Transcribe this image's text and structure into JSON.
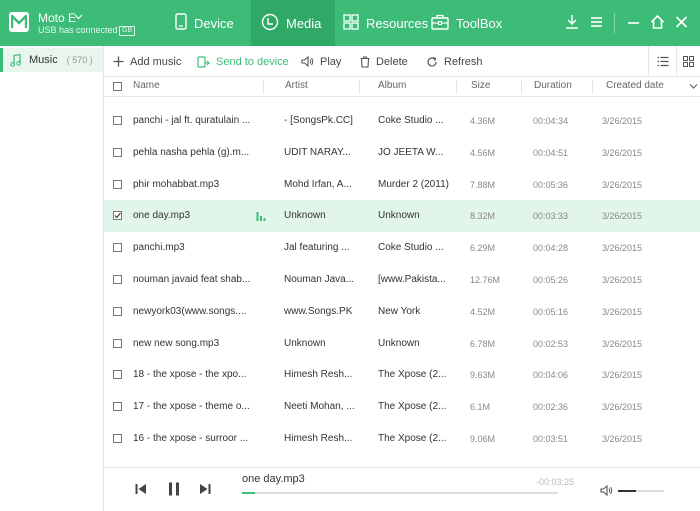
{
  "device": {
    "name": "Moto E",
    "status": "USB has connected",
    "badge": "GB"
  },
  "nav": {
    "device": "Device",
    "media": "Media",
    "resources": "Resources",
    "toolbox": "ToolBox"
  },
  "sidebar": {
    "items": [
      {
        "label": "Music",
        "count": "( 570 )"
      }
    ]
  },
  "toolbar": {
    "add": "Add music",
    "send": "Send to device",
    "play": "Play",
    "delete": "Delete",
    "refresh": "Refresh"
  },
  "columns": {
    "name": "Name",
    "artist": "Artist",
    "album": "Album",
    "size": "Size",
    "duration": "Duration",
    "created": "Created date"
  },
  "rows": [
    {
      "name": "panchi - jal ft. quratulain ...",
      "artist": "- [SongsPk.CC]",
      "album": "Coke Studio ...",
      "size": "4.36M",
      "duration": "00:04:34",
      "date": "3/26/2015",
      "selected": false
    },
    {
      "name": "pehla nasha pehla (g).m...",
      "artist": "UDIT NARAY...",
      "album": "JO JEETA W...",
      "size": "4.56M",
      "duration": "00:04:51",
      "date": "3/26/2015",
      "selected": false
    },
    {
      "name": "phir mohabbat.mp3",
      "artist": "Mohd Irfan, A...",
      "album": "Murder 2 (2011)",
      "size": "7.88M",
      "duration": "00:05:36",
      "date": "3/26/2015",
      "selected": false
    },
    {
      "name": "one day.mp3",
      "artist": "Unknown",
      "album": "Unknown",
      "size": "8.32M",
      "duration": "00:03:33",
      "date": "3/26/2015",
      "selected": true
    },
    {
      "name": "panchi.mp3",
      "artist": "Jal featuring ...",
      "album": "Coke Studio ...",
      "size": "6.29M",
      "duration": "00:04:28",
      "date": "3/26/2015",
      "selected": false
    },
    {
      "name": "nouman javaid feat shab...",
      "artist": "Nouman Java...",
      "album": "[www.Pakista...",
      "size": "12.76M",
      "duration": "00:05:26",
      "date": "3/26/2015",
      "selected": false
    },
    {
      "name": "newyork03(www.songs....",
      "artist": "www.Songs.PK",
      "album": "New York",
      "size": "4.52M",
      "duration": "00:05:16",
      "date": "3/26/2015",
      "selected": false
    },
    {
      "name": "new new song.mp3",
      "artist": "Unknown",
      "album": "Unknown",
      "size": "6.78M",
      "duration": "00:02:53",
      "date": "3/26/2015",
      "selected": false
    },
    {
      "name": "18 - the xpose - the xpo...",
      "artist": "Himesh Resh...",
      "album": "The Xpose (2...",
      "size": "9.63M",
      "duration": "00:04:06",
      "date": "3/26/2015",
      "selected": false
    },
    {
      "name": "17 - the xpose - theme o...",
      "artist": "Neeti Mohan, ...",
      "album": "The Xpose (2...",
      "size": "6.1M",
      "duration": "00:02:36",
      "date": "3/26/2015",
      "selected": false
    },
    {
      "name": "16 - the xpose - surroor ...",
      "artist": "Himesh Resh...",
      "album": "The Xpose (2...",
      "size": "9.06M",
      "duration": "00:03:51",
      "date": "3/26/2015",
      "selected": false
    }
  ],
  "player": {
    "track": "one day.mp3",
    "time": "-00:03:25",
    "progress": 0.04,
    "volume": 0.4
  },
  "colors": {
    "accent": "#3dbc78",
    "accent_dark": "#2fa965",
    "selected_row": "#e1f5ea"
  },
  "icons": [
    "app-logo-icon",
    "chevron-down-icon",
    "phone-icon",
    "media-icon",
    "grid-icon",
    "toolbox-icon",
    "download-icon",
    "menu-icon",
    "minimize-icon",
    "home-icon",
    "close-icon",
    "music-note-icon",
    "plus-icon",
    "send-icon",
    "speaker-icon",
    "trash-icon",
    "refresh-icon",
    "list-view-icon",
    "grid-view-icon",
    "playing-icon",
    "prev-icon",
    "pause-icon",
    "next-icon",
    "volume-icon"
  ]
}
